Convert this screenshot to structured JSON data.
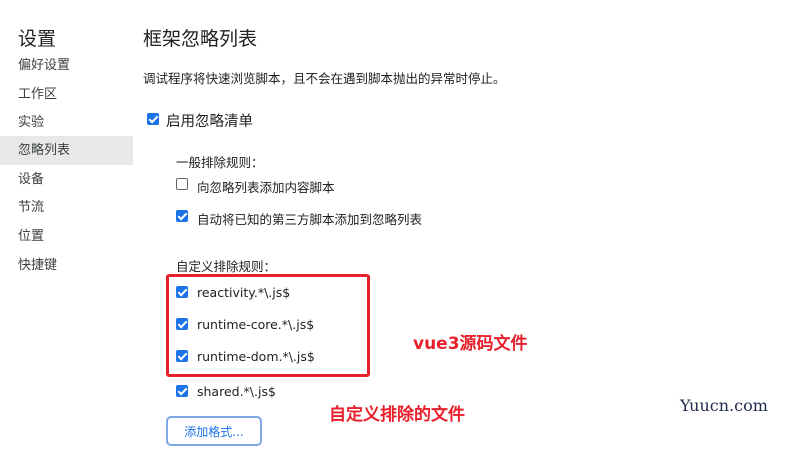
{
  "sidebar": {
    "title": "设置",
    "items": [
      {
        "label": "偏好设置"
      },
      {
        "label": "工作区"
      },
      {
        "label": "实验"
      },
      {
        "label": "忽略列表"
      },
      {
        "label": "设备"
      },
      {
        "label": "节流"
      },
      {
        "label": "位置"
      },
      {
        "label": "快捷键"
      }
    ],
    "active_item": "忽略列表"
  },
  "main": {
    "title": "框架忽略列表",
    "description": "调试程序将快速浏览脚本，且不会在遇到脚本抛出的异常时停止。",
    "enable_ignore_list": {
      "label": "启用忽略清单",
      "checked": true
    },
    "general_rules": {
      "heading": "一般排除规则：",
      "rules": [
        {
          "label": "向忽略列表添加内容脚本",
          "checked": false
        },
        {
          "label": "自动将已知的第三方脚本添加到忽略列表",
          "checked": true
        }
      ]
    },
    "custom_rules": {
      "heading": "自定义排除规则：",
      "rules": [
        {
          "label": "reactivity.*\\.js$",
          "checked": true
        },
        {
          "label": "runtime-core.*\\.js$",
          "checked": true
        },
        {
          "label": "runtime-dom.*\\.js$",
          "checked": true
        },
        {
          "label": "shared.*\\.js$",
          "checked": true
        }
      ]
    },
    "add_pattern_button": "添加格式..."
  },
  "annotations": {
    "vue3_source": "vue3源码文件",
    "custom_excluded": "自定义排除的文件"
  },
  "watermark": "Yuucn.com",
  "colors": {
    "accent": "#1a73e8",
    "annotation_red": "#e8202c",
    "active_sidebar_bg": "#e8e8e8"
  }
}
